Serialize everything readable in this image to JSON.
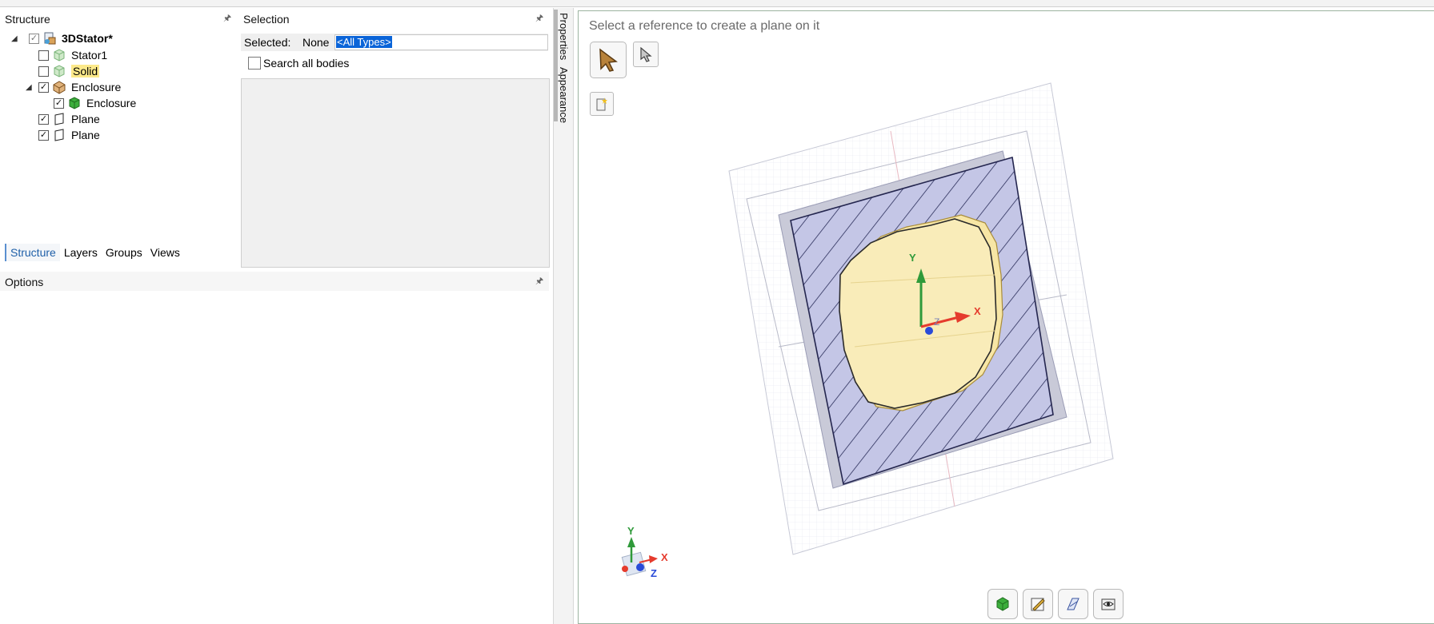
{
  "structure": {
    "title": "Structure",
    "tree": [
      {
        "label": "3DStator*",
        "checked": true,
        "icon": "document-assembly-icon"
      },
      {
        "label": "Stator1",
        "checked": false,
        "icon": "solid-body-icon"
      },
      {
        "label": "Solid",
        "checked": false,
        "icon": "solid-body-icon"
      },
      {
        "label": "Enclosure",
        "checked": true,
        "icon": "component-icon"
      },
      {
        "label": "Enclosure",
        "checked": true,
        "icon": "solid-body-green-icon"
      },
      {
        "label": "Plane",
        "checked": true,
        "icon": "plane-icon"
      },
      {
        "label": "Plane",
        "checked": true,
        "icon": "plane-icon"
      }
    ],
    "tabs": [
      "Structure",
      "Layers",
      "Groups",
      "Views"
    ]
  },
  "selection": {
    "title": "Selection",
    "selected_label": "Selected:",
    "selected_value": "None",
    "filter_value": "<All Types>",
    "search_all_label": "Search all bodies"
  },
  "options": {
    "title": "Options"
  },
  "side_tabs": [
    "Properties",
    "Appearance"
  ],
  "viewport": {
    "instruction": "Select a reference to create a plane on it",
    "axis_x": "X",
    "axis_y": "Y",
    "axis_z": "Z"
  },
  "colors": {
    "accent": "#1e5fa8",
    "highlight": "#fce98a",
    "selection_bg": "#0a64d8",
    "plane_fill": "#c4c6e6",
    "body_fill": "#f6e4a2",
    "axis_x": "#e53b2d",
    "axis_y": "#2f9a3a",
    "axis_z": "#2a4bd8"
  }
}
